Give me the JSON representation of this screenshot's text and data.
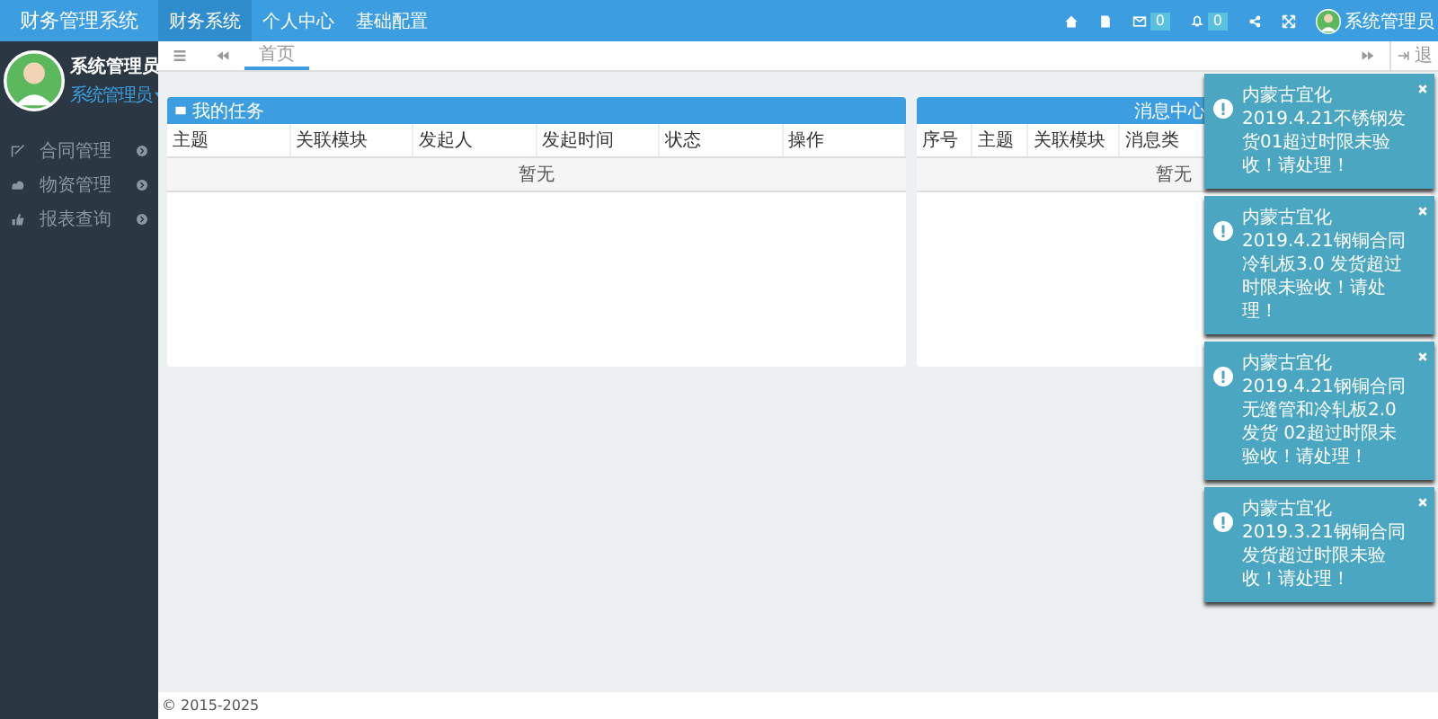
{
  "app": {
    "title": "财务管理系统"
  },
  "nav_tabs": [
    {
      "label": "财务系统",
      "selected": true
    },
    {
      "label": "个人中心",
      "selected": false
    },
    {
      "label": "基础配置",
      "selected": false
    }
  ],
  "header": {
    "mail_count": "0",
    "alert_count": "0",
    "user": "系统管理员"
  },
  "sidebar": {
    "user_name": "系统管理员",
    "role": "系统管理员",
    "items": [
      {
        "label": "合同管理"
      },
      {
        "label": "物资管理"
      },
      {
        "label": "报表查询"
      }
    ]
  },
  "tabbar": {
    "tabs": [
      {
        "label": "首页",
        "selected": true
      }
    ],
    "exit_label": "退"
  },
  "tasks_panel": {
    "title": "我的任务",
    "columns": [
      "主题",
      "关联模块",
      "发起人",
      "发起时间",
      "状态",
      "操作"
    ],
    "empty": "暂无"
  },
  "messages_panel": {
    "title": "消息中心",
    "columns": [
      "序号",
      "主题",
      "关联模块",
      "消息类"
    ],
    "empty": "暂无"
  },
  "notifications": [
    {
      "text": "内蒙古宜化2019.4.21不锈钢发货01超过时限未验收！请处理！"
    },
    {
      "text": "内蒙古宜化2019.4.21钢铜合同冷轧板3.0 发货超过时限未验收！请处理！"
    },
    {
      "text": "内蒙古宜化2019.4.21钢铜合同无缝管和冷轧板2.0 发货 02超过时限未验收！请处理！"
    },
    {
      "text": "内蒙古宜化2019.3.21钢铜合同发货超过时限未验收！请处理！"
    }
  ],
  "footer": "© 2015-2025"
}
